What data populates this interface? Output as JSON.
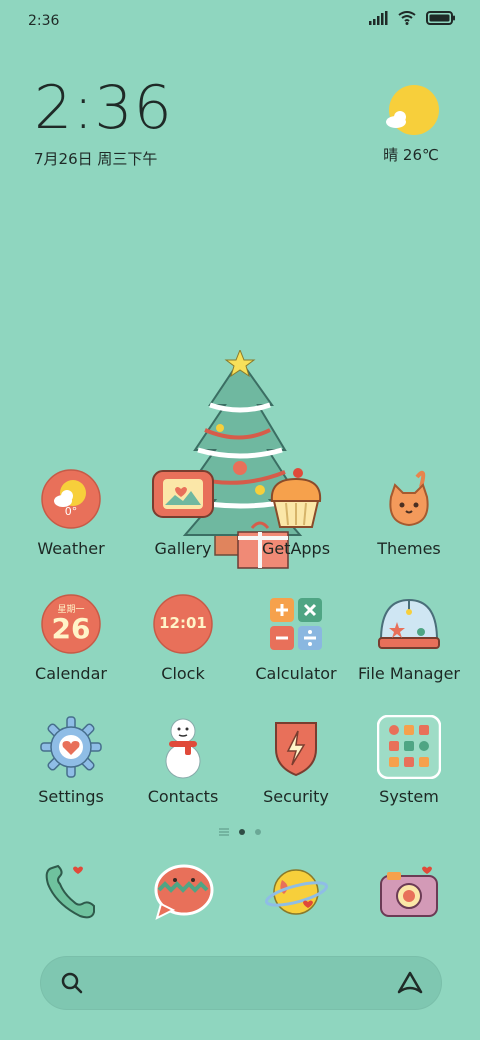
{
  "status_bar": {
    "time": "2:36"
  },
  "clock_widget": {
    "time": "2:36",
    "date": "7月26日 周三下午"
  },
  "weather_widget": {
    "label": "晴 26℃"
  },
  "apps": {
    "weather": {
      "label": "Weather",
      "temp": "0°"
    },
    "gallery": {
      "label": "Gallery"
    },
    "getapps": {
      "label": "GetApps"
    },
    "themes": {
      "label": "Themes"
    },
    "calendar": {
      "label": "Calendar",
      "day": "26",
      "weekday": "星期一"
    },
    "clock": {
      "label": "Clock",
      "time": "12:01"
    },
    "calculator": {
      "label": "Calculator"
    },
    "filemanager": {
      "label": "File Manager"
    },
    "settings": {
      "label": "Settings"
    },
    "contacts": {
      "label": "Contacts"
    },
    "security": {
      "label": "Security"
    },
    "system": {
      "label": "System"
    }
  },
  "dock": [
    "phone",
    "messages",
    "browser",
    "camera"
  ],
  "pager": {
    "pages": 2,
    "active": 1
  },
  "colors": {
    "background": "#8fd6bf",
    "accent_red": "#e8705a",
    "accent_yellow": "#f7cf3b"
  }
}
